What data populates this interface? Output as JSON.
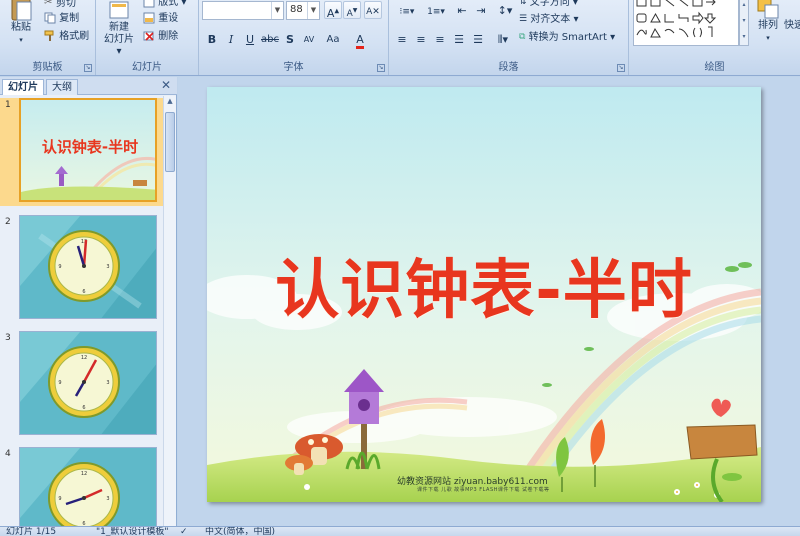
{
  "ribbon": {
    "groups": {
      "clipboard": {
        "label": "剪贴板",
        "paste": "粘贴",
        "cut": "剪切",
        "copy": "复制",
        "format_painter": "格式刷"
      },
      "slides": {
        "label": "幻灯片",
        "new_slide_line1": "新建",
        "new_slide_line2": "幻灯片",
        "layout": "版式",
        "reset": "重设",
        "delete": "删除"
      },
      "font": {
        "label": "字体",
        "font_name": "",
        "font_size": "88"
      },
      "paragraph": {
        "label": "段落",
        "text_direction": "文字方向",
        "align_text": "对齐文本",
        "convert_smartart": "转换为 SmartArt"
      },
      "drawing": {
        "label": "绘图",
        "arrange": "排列",
        "quick_styles": "快速"
      }
    }
  },
  "left_pane": {
    "tab_slides": "幻灯片",
    "tab_outline": "大纲",
    "close": "✕",
    "thumbnails": [
      {
        "number": "1",
        "title": "认识钟表-半时"
      },
      {
        "number": "2"
      },
      {
        "number": "3"
      },
      {
        "number": "4"
      }
    ]
  },
  "slide": {
    "title": "认识钟表-半时",
    "footer": "幼教资源网站  ziyuan.baby611.com",
    "footer_sub": "课件下载  儿歌  故事MP3  FLASH课件下载  试卷下载等"
  },
  "status_bar": {
    "slide_counter": "幻灯片 1/15",
    "theme": "\"1_默认设计模板\"",
    "language": "中文(简体，中国)"
  },
  "colors": {
    "title_red": "#e8361e",
    "selected_thumb": "#fcd98d"
  }
}
